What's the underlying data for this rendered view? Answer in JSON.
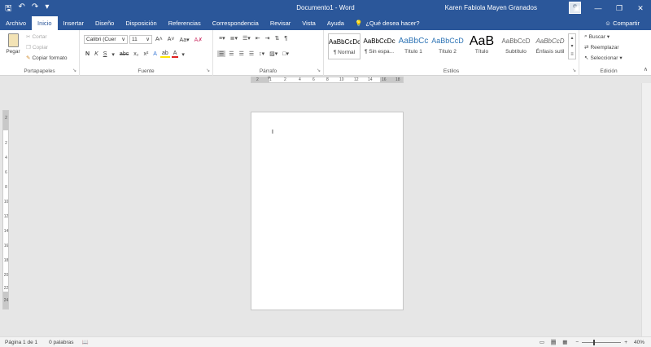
{
  "titlebar": {
    "title": "Documento1  -  Word",
    "user": "Karen Fabiola Mayen Granados",
    "icons": [
      "save-icon",
      "undo-icon",
      "redo-icon",
      "customize-qat-icon"
    ]
  },
  "tabs": [
    "Archivo",
    "Inicio",
    "Insertar",
    "Diseño",
    "Disposición",
    "Referencias",
    "Correspondencia",
    "Revisar",
    "Vista",
    "Ayuda"
  ],
  "active_tab": "Inicio",
  "tell_me": "¿Qué desea hacer?",
  "share": "Compartir",
  "clipboard": {
    "paste": "Pegar",
    "cut": "Cortar",
    "copy": "Copiar",
    "format_painter": "Copiar formato",
    "label": "Portapapeles"
  },
  "font": {
    "name": "Calibri (Cuer",
    "size": "11",
    "label": "Fuente"
  },
  "paragraph": {
    "label": "Párrafo"
  },
  "styles": {
    "label": "Estilos",
    "items": [
      {
        "preview": "AaBbCcDc",
        "name": "¶ Normal"
      },
      {
        "preview": "AaBbCcDc",
        "name": "¶ Sin espa..."
      },
      {
        "preview": "AaBbCc",
        "name": "Título 1"
      },
      {
        "preview": "AaBbCcD",
        "name": "Título 2"
      },
      {
        "preview": "AaB",
        "name": "Título"
      },
      {
        "preview": "AaBbCcD",
        "name": "Subtítulo"
      },
      {
        "preview": "AaBbCcD",
        "name": "Énfasis sutil"
      }
    ]
  },
  "editing": {
    "find": "Buscar",
    "replace": "Reemplazar",
    "select": "Seleccionar",
    "label": "Edición"
  },
  "ruler": {
    "h_ticks": [
      "2",
      "1",
      "2",
      "4",
      "6",
      "8",
      "10",
      "12",
      "14",
      "16",
      "18"
    ],
    "v_ticks": [
      "2",
      "2",
      "4",
      "6",
      "8",
      "10",
      "12",
      "14",
      "16",
      "18",
      "20",
      "22",
      "24"
    ]
  },
  "status": {
    "page": "Página 1 de 1",
    "words": "0 palabras",
    "zoom": "40%"
  }
}
